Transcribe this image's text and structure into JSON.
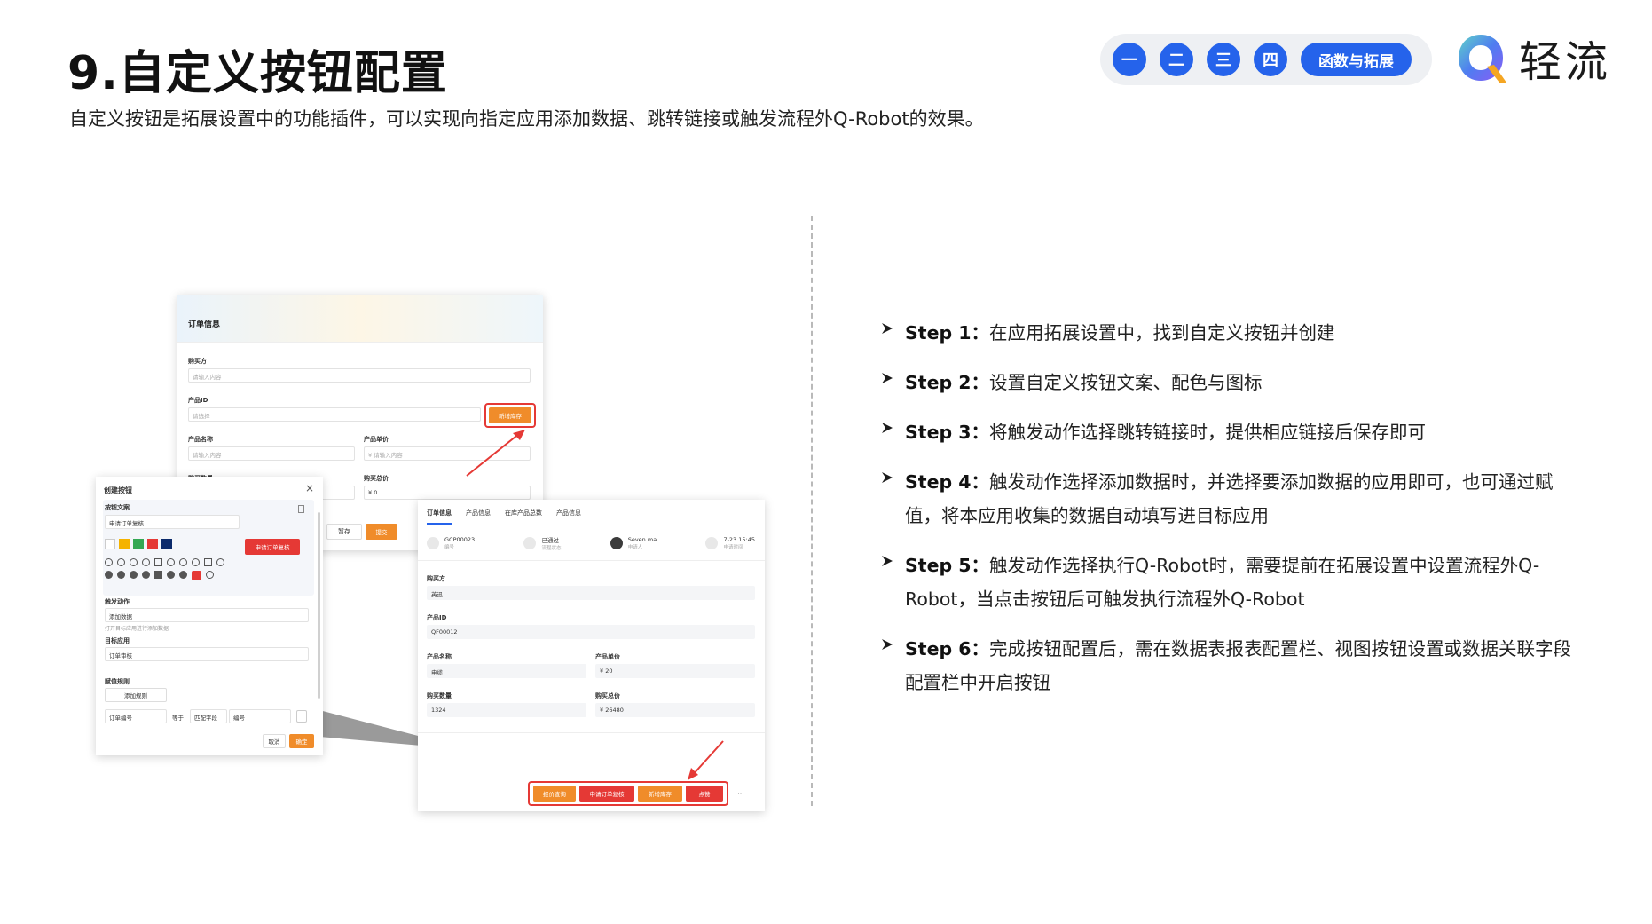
{
  "header": {
    "title": "9.自定义按钮配置",
    "subtitle": "自定义按钮是拓展设置中的功能插件，可以实现向指定应用添加数据、跳转链接或触发流程外Q-Robot的效果。"
  },
  "nav": {
    "items": [
      "一",
      "二",
      "三",
      "四",
      "函数与拓展"
    ],
    "accent": "#2563eb"
  },
  "logo": {
    "text": "轻流"
  },
  "steps": [
    {
      "label": "Step 1：",
      "text": "在应用拓展设置中，找到自定义按钮并创建"
    },
    {
      "label": "Step 2：",
      "text": "设置自定义按钮文案、配色与图标"
    },
    {
      "label": "Step 3：",
      "text": "将触发动作选择跳转链接时，提供相应链接后保存即可"
    },
    {
      "label": "Step 4：",
      "text": "触发动作选择添加数据时，并选择要添加数据的应用即可，也可通过赋值，将本应用收集的数据自动填写进目标应用"
    },
    {
      "label": "Step 5：",
      "text": "触发动作选择执行Q-Robot时，需要提前在拓展设置中设置流程外Q-Robot，当点击按钮后可触发执行流程外Q-Robot"
    },
    {
      "label": "Step 6：",
      "text": "完成按钮配置后，需在数据表报表配置栏、视图按钮设置或数据关联字段配置栏中开启按钮"
    }
  ],
  "order_form": {
    "title": "订单信息",
    "buyer_label": "购买方",
    "buyer_placeholder": "请输入内容",
    "product_id_label": "产品ID",
    "product_id_placeholder": "请选择",
    "add_stock_button": "新增库存",
    "product_name_label": "产品名称",
    "product_name_placeholder": "请输入内容",
    "unit_price_label": "产品单价",
    "unit_price_placeholder": "¥ 请输入内容",
    "qty_label": "购买数量",
    "total_label": "购买总价",
    "total_value": "¥ 0",
    "save_draft": "暂存",
    "submit": "提交"
  },
  "create_button_dialog": {
    "title": "创建按钮",
    "close": "×",
    "text_label": "按钮文案",
    "text_value": "申请订单复核",
    "preview_button": "申请订单复核",
    "action_label": "触发动作",
    "action_value": "添加数据",
    "action_hint": "打开目标应用进行添加数据",
    "target_label": "目标应用",
    "target_value": "订单审核",
    "rule_label": "赋值规则",
    "add_rule": "添加规则",
    "rule_field": "订单编号",
    "rule_op": "等于",
    "rule_type": "匹配字段",
    "rule_value": "编号",
    "cancel": "取消",
    "confirm": "确定",
    "swatches": [
      "#ffffff",
      "#f5b300",
      "#34a853",
      "#e53935",
      "#0b2a6b"
    ]
  },
  "detail_view": {
    "tabs": [
      "订单信息",
      "产品信息",
      "在库产品总数",
      "产品信息"
    ],
    "meta": [
      {
        "value": "GCP00023",
        "caption": "编号"
      },
      {
        "value": "已通过",
        "caption": "流程状态"
      },
      {
        "value": "Seven.ma",
        "caption": "申请人"
      },
      {
        "value": "7-23 15:45",
        "caption": "申请时间"
      }
    ],
    "buyer_label": "购买方",
    "buyer_value": "英迅",
    "product_id_label": "产品ID",
    "product_id_value": "QF00012",
    "product_name_label": "产品名称",
    "product_name_value": "电缆",
    "unit_price_label": "产品单价",
    "unit_price_value": "¥ 20",
    "qty_label": "购买数量",
    "qty_value": "1324",
    "total_label": "购买总价",
    "total_value": "¥ 26480",
    "buttons": [
      "报价查询",
      "申请订单复核",
      "新增库存",
      "点赞"
    ],
    "more": "···"
  }
}
